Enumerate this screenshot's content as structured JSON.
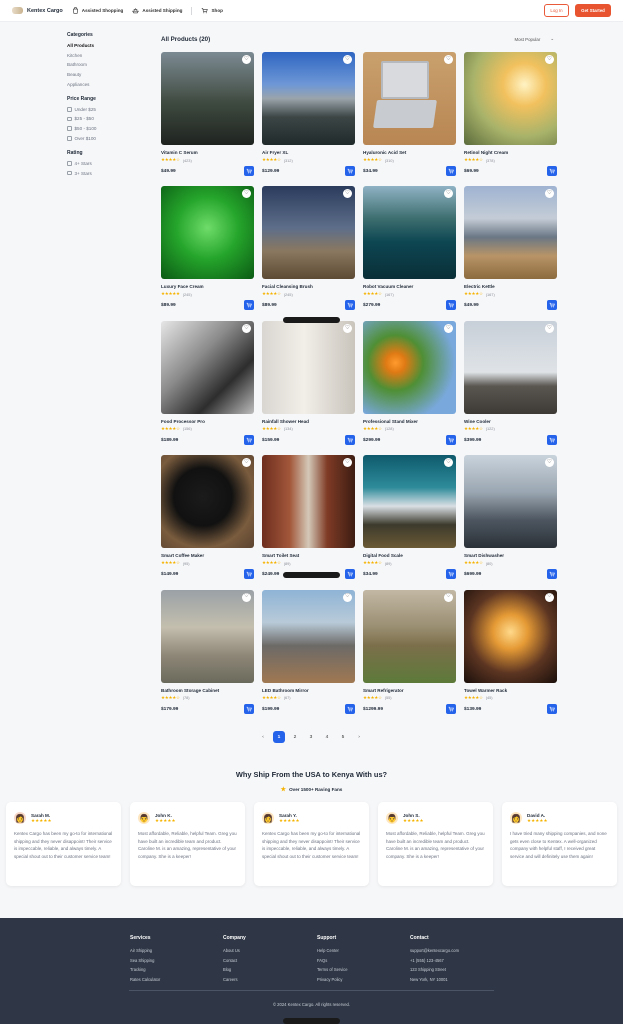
{
  "header": {
    "brand": "Kentex Cargo",
    "nav": [
      "Assisted Shopping",
      "Assisted Shipping",
      "Shop"
    ],
    "login": "Log In",
    "cta": "Get Started"
  },
  "sidebar": {
    "categories_title": "Categories",
    "categories": [
      "All Products",
      "Kitchen",
      "Bathroom",
      "Beauty",
      "Appliances"
    ],
    "price_title": "Price Range",
    "prices": [
      "Under $25",
      "$25 - $50",
      "$50 - $100",
      "Over $100"
    ],
    "rating_title": "Rating",
    "ratings": [
      "4+ Stars",
      "3+ Stars"
    ]
  },
  "main": {
    "title": "All Products (20)",
    "sort": "Most Popular"
  },
  "products": [
    {
      "name": "Vitamin C Serum",
      "stars": "★★★★☆",
      "count": "(423)",
      "price": "$49.99"
    },
    {
      "name": "Air Fryer XL",
      "stars": "★★★★☆",
      "count": "(312)",
      "price": "$129.99"
    },
    {
      "name": "Hyaluronic Acid Set",
      "stars": "★★★★☆",
      "count": "(310)",
      "price": "$34.99"
    },
    {
      "name": "Retinol Night Cream",
      "stars": "★★★★☆",
      "count": "(378)",
      "price": "$69.99"
    },
    {
      "name": "Luxury Face Cream",
      "stars": "★★★★★",
      "count": "(245)",
      "price": "$89.99"
    },
    {
      "name": "Facial Cleansing Brush",
      "stars": "★★★★☆",
      "count": "(245)",
      "price": "$89.99"
    },
    {
      "name": "Robot Vacuum Cleaner",
      "stars": "★★★★☆",
      "count": "(167)",
      "price": "$279.99"
    },
    {
      "name": "Electric Kettle",
      "stars": "★★★★☆",
      "count": "(167)",
      "price": "$49.99"
    },
    {
      "name": "Food Processor Pro",
      "stars": "★★★★☆",
      "count": "(156)",
      "price": "$189.99"
    },
    {
      "name": "Rainfall Shower Head",
      "stars": "★★★★☆",
      "count": "(134)",
      "price": "$159.99"
    },
    {
      "name": "Professional Stand Mixer",
      "stars": "★★★★☆",
      "count": "(128)",
      "price": "$299.99"
    },
    {
      "name": "Wine Cooler",
      "stars": "★★★★☆",
      "count": "(122)",
      "price": "$399.99"
    },
    {
      "name": "Smart Coffee Maker",
      "stars": "★★★★☆",
      "count": "(95)",
      "price": "$149.99"
    },
    {
      "name": "Smart Toilet Seat",
      "stars": "★★★★☆",
      "count": "(89)",
      "price": "$249.99"
    },
    {
      "name": "Digital Food Scale",
      "stars": "★★★★☆",
      "count": "(89)",
      "price": "$34.99"
    },
    {
      "name": "Smart Dishwasher",
      "stars": "★★★★☆",
      "count": "(80)",
      "price": "$699.99"
    },
    {
      "name": "Bathroom Storage Cabinet",
      "stars": "★★★★☆",
      "count": "(78)",
      "price": "$179.99"
    },
    {
      "name": "LED Bathroom Mirror",
      "stars": "★★★★☆",
      "count": "(67)",
      "price": "$199.99"
    },
    {
      "name": "Smart Refrigerator",
      "stars": "★★★★☆",
      "count": "(55)",
      "price": "$1299.99"
    },
    {
      "name": "Towel Warmer Rack",
      "stars": "★★★★☆",
      "count": "(45)",
      "price": "$139.99"
    }
  ],
  "pagination": {
    "pages": [
      "1",
      "2",
      "3",
      "4",
      "5"
    ],
    "current": "1",
    "prev": "‹",
    "next": "›"
  },
  "why": {
    "title": "Why Ship From the USA to Kenya With us?",
    "fans": "Over 1500+ Raving Fans"
  },
  "testimonials": [
    {
      "name": "Sarah M.",
      "stars": "★★★★★",
      "text": "Kentex Cargo has been my go-to for international shipping and they never disappoint! Their service is impeccable, reliable, and always timely. A special shout out to their customer service team!"
    },
    {
      "name": "John K.",
      "stars": "★★★★★",
      "text": "Most affordable, Reliable, helpful Team. Greg you have built an incredible team and product. Caroline M. is an amazing, representative of your company. She is a keeper!"
    },
    {
      "name": "Sarah Y.",
      "stars": "★★★★★",
      "text": "Kentex Cargo has been my go-to for international shipping and they never disappoint! Their service is impeccable, reliable, and always timely. A special shout out to their customer service team!"
    },
    {
      "name": "John S.",
      "stars": "★★★★★",
      "text": "Most affordable, Reliable, helpful Team. Greg you have built an incredible team and product. Caroline M. is an amazing, representative of your company. She is a keeper!"
    },
    {
      "name": "David A.",
      "stars": "★★★★★",
      "text": "I have tried many shipping companies, and none gets even close to Kentex. A well-organized company with helpful staff, I received great service and will definitely use them again!"
    }
  ],
  "footer": {
    "services": {
      "title": "Services",
      "items": [
        "Air Shipping",
        "Sea Shipping",
        "Tracking",
        "Rates Calculator"
      ]
    },
    "company": {
      "title": "Company",
      "items": [
        "About Us",
        "Contact",
        "Blog",
        "Careers"
      ]
    },
    "support": {
      "title": "Support",
      "items": [
        "Help Center",
        "FAQs",
        "Terms of Service",
        "Privacy Policy"
      ]
    },
    "contact": {
      "title": "Contact",
      "items": [
        "support@kentexcargo.com",
        "+1 (555) 123-4567",
        "123 Shipping Street",
        "New York, NY 10001"
      ]
    },
    "copyright": "© 2024 Kentex Cargo. All rights reserved."
  }
}
